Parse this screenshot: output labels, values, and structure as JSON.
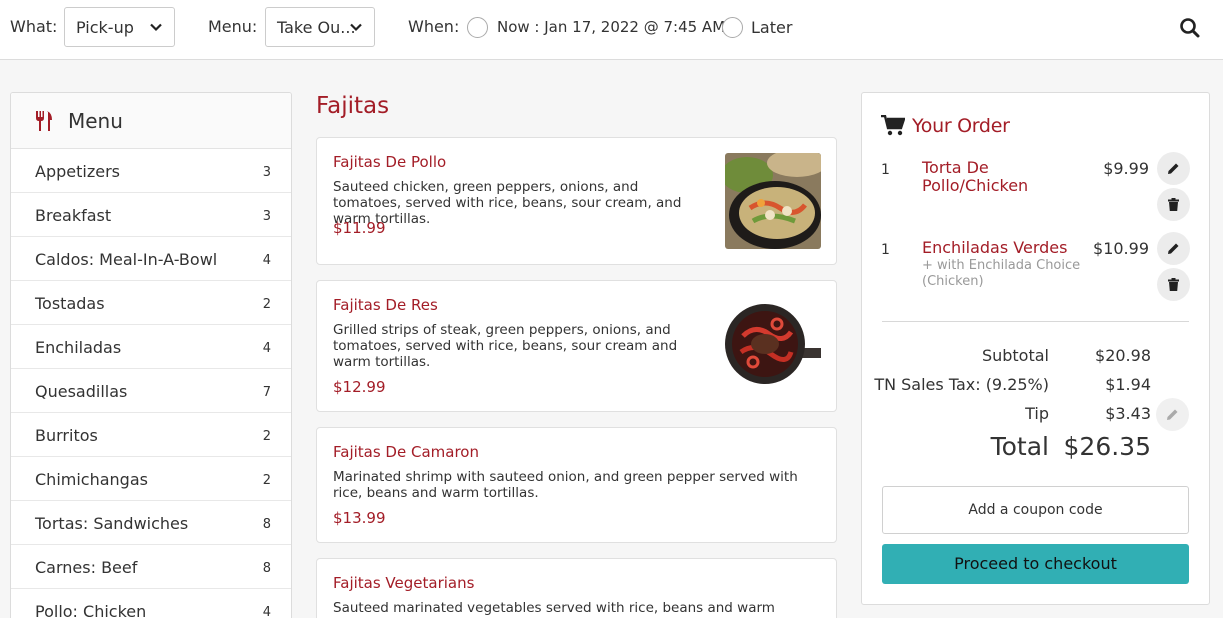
{
  "topbar": {
    "what_label": "What:",
    "what_value": "Pick-up",
    "menu_label": "Menu:",
    "menu_value": "Take Ou...",
    "when_label": "When:",
    "now_label": "Now : Jan 17, 2022 @ 7:45 AM.",
    "later_label": "Later",
    "icons": {
      "chevron": "chevron-down-icon",
      "search": "search-icon"
    }
  },
  "sidebar": {
    "title": "Menu",
    "icon": "utensils-icon",
    "categories": [
      {
        "name": "Appetizers",
        "count": "3"
      },
      {
        "name": "Breakfast",
        "count": "3"
      },
      {
        "name": "Caldos: Meal-In-A-Bowl",
        "count": "4"
      },
      {
        "name": "Tostadas",
        "count": "2"
      },
      {
        "name": "Enchiladas",
        "count": "4"
      },
      {
        "name": "Quesadillas",
        "count": "7"
      },
      {
        "name": "Burritos",
        "count": "2"
      },
      {
        "name": "Chimichangas",
        "count": "2"
      },
      {
        "name": "Tortas: Sandwiches",
        "count": "8"
      },
      {
        "name": "Carnes: Beef",
        "count": "8"
      },
      {
        "name": "Pollo: Chicken",
        "count": "4"
      }
    ]
  },
  "section": {
    "title": "Fajitas",
    "items": [
      {
        "name": "Fajitas De Pollo",
        "desc": "Sauteed chicken, green peppers, onions, and tomatoes, served with rice, beans, sour cream, and warm tortillas.",
        "price": "$11.99"
      },
      {
        "name": "Fajitas De Res",
        "desc": "Grilled strips of steak, green peppers, onions, and tomatoes, served with rice, beans, sour cream and warm tortillas.",
        "price": "$12.99"
      },
      {
        "name": "Fajitas De Camaron",
        "desc": "Marinated shrimp with sauteed onion, and green pepper served with rice, beans and warm tortillas.",
        "price": "$13.99"
      },
      {
        "name": "Fajitas Vegetarians",
        "desc": "Sauteed marinated vegetables served with rice, beans and warm tortillas."
      }
    ]
  },
  "order": {
    "title": "Your Order",
    "icon": "cart-icon",
    "lines": [
      {
        "qty": "1",
        "name": "Torta De Pollo/Chicken",
        "modifier": "",
        "price": "$9.99"
      },
      {
        "qty": "1",
        "name": "Enchiladas Verdes",
        "modifier": "+ with Enchilada Choice (Chicken)",
        "price": "$10.99"
      }
    ],
    "subtotal_label": "Subtotal",
    "subtotal": "$20.98",
    "tax_label": "TN Sales Tax: (9.25%)",
    "tax": "$1.94",
    "tip_label": "Tip",
    "tip": "$3.43",
    "total_label": "Total",
    "total": "$26.35",
    "coupon_label": "Add a coupon code",
    "checkout_label": "Proceed to checkout",
    "colors": {
      "accent": "#a31d27",
      "checkout": "#31afb4"
    }
  }
}
